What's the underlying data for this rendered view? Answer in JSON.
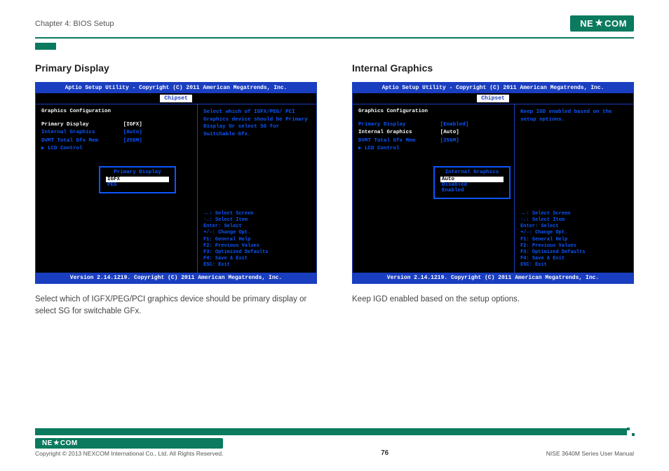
{
  "header": {
    "chapter": "Chapter 4: BIOS Setup",
    "brand_pre": "NE",
    "brand_post": "COM"
  },
  "sections": {
    "left": {
      "title": "Primary Display",
      "caption": "Select which of IGFX/PEG/PCI graphics device should be primary display or select SG for switchable GFx.",
      "bios": {
        "top": "Aptio Setup Utility - Copyright (C) 2011 American Megatrends, Inc.",
        "tab": "Chipset",
        "cfg_title": "Graphics Configuration",
        "rows": [
          {
            "label": "Primary Display",
            "val": "[IGFX]",
            "selected": true
          },
          {
            "label": "Internal Graphics",
            "val": "[Auto]"
          },
          {
            "label": "DVMT Total Gfx Mem",
            "val": "[256M]"
          },
          {
            "label": "▶ LCD Control",
            "val": ""
          }
        ],
        "popup": {
          "title": "Primary Display",
          "opts": [
            "IGFX",
            "PEG"
          ],
          "sel": 0
        },
        "help": "Select which of IGFX/PEG/ PCI Graphics device should be Primary Display Or select SG for Switchable Gfx.",
        "bottom": "Version 2.14.1219. Copyright (C) 2011 American Megatrends, Inc."
      }
    },
    "right": {
      "title": "Internal Graphics",
      "caption": "Keep IGD enabled based on the setup options.",
      "bios": {
        "top": "Aptio Setup Utility - Copyright (C) 2011 American Megatrends, Inc.",
        "tab": "Chipset",
        "cfg_title": "Graphics Configuration",
        "rows": [
          {
            "label": "Primary Display",
            "val": "[Enabled]"
          },
          {
            "label": "Internal Graphics",
            "val": "[Auto]",
            "selected": true
          },
          {
            "label": "DVMT Total Gfx Mem",
            "val": "[256M]"
          },
          {
            "label": "▶ LCD Control",
            "val": ""
          }
        ],
        "popup": {
          "title": "Internal Graphics",
          "opts": [
            "Auto",
            "Disabled",
            "Enabled"
          ],
          "sel": 0
        },
        "help": "Keep IGD enabled based on the setup options.",
        "bottom": "Version 2.14.1219. Copyright (C) 2011 American Megatrends, Inc."
      }
    }
  },
  "keys": [
    "→←: Select Screen",
    "↑↓: Select Item",
    "Enter: Select",
    "+/-: Change Opt.",
    "F1: General Help",
    "F2: Previous Values",
    "F3: Optimized Defaults",
    "F4: Save & Exit",
    "ESC: Exit"
  ],
  "footer": {
    "copyright": "Copyright © 2013 NEXCOM International Co., Ltd. All Rights Reserved.",
    "page": "76",
    "manual": "NISE 3640M Series User Manual"
  }
}
